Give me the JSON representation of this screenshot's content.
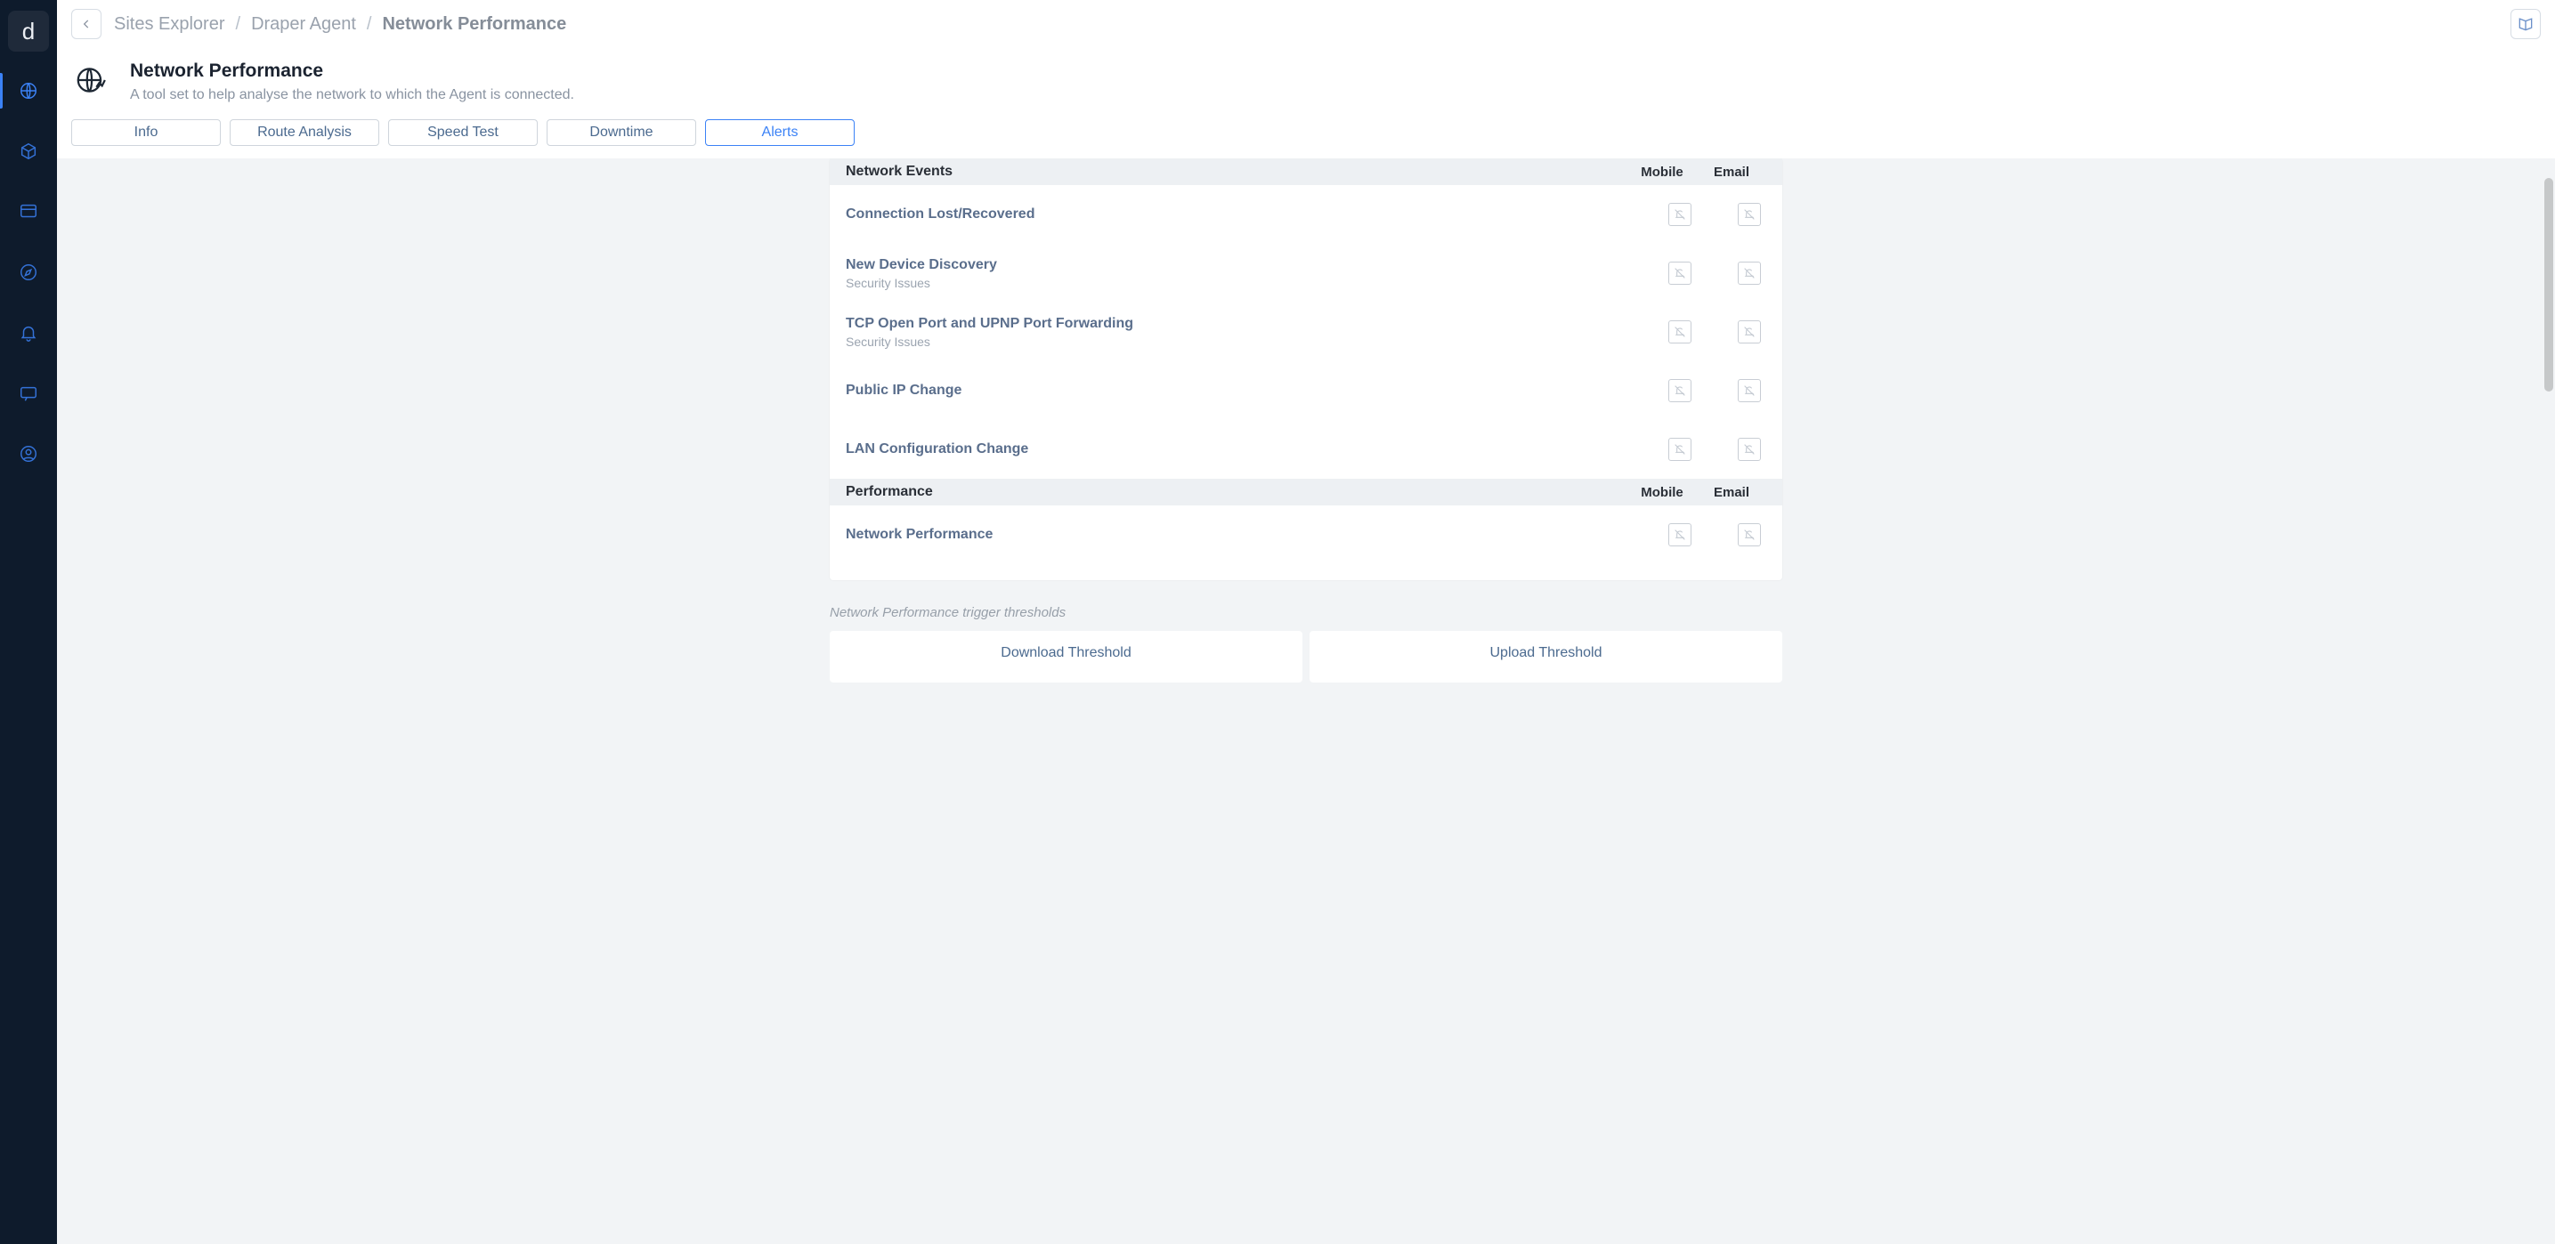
{
  "brand": {
    "logo_letter": "d"
  },
  "sidebar": {
    "items": [
      {
        "name": "globe-icon",
        "active": true
      },
      {
        "name": "box-icon",
        "active": false
      },
      {
        "name": "dashboard-icon",
        "active": false
      },
      {
        "name": "compass-icon",
        "active": false
      },
      {
        "name": "bell-icon",
        "active": false
      },
      {
        "name": "message-icon",
        "active": false
      },
      {
        "name": "user-icon",
        "active": false
      }
    ]
  },
  "breadcrumb": {
    "items": [
      "Sites Explorer",
      "Draper Agent",
      "Network Performance"
    ]
  },
  "page": {
    "title": "Network Performance",
    "subtitle": "A tool set to help analyse the network to which the Agent is connected."
  },
  "tabs": [
    "Info",
    "Route Analysis",
    "Speed Test",
    "Downtime",
    "Alerts"
  ],
  "active_tab": "Alerts",
  "columns": {
    "mobile": "Mobile",
    "email": "Email"
  },
  "sections": [
    {
      "label": "Network Events",
      "rows": [
        {
          "title": "Connection Lost/Recovered",
          "sub": ""
        },
        {
          "title": "New Device Discovery",
          "sub": "Security Issues"
        },
        {
          "title": "TCP Open Port and UPNP Port Forwarding",
          "sub": "Security Issues"
        },
        {
          "title": "Public IP Change",
          "sub": ""
        },
        {
          "title": "LAN Configuration Change",
          "sub": ""
        }
      ]
    },
    {
      "label": "Performance",
      "rows": [
        {
          "title": "Network Performance",
          "sub": ""
        }
      ]
    }
  ],
  "thresholds": {
    "caption": "Network Performance trigger thresholds",
    "cards": [
      "Download Threshold",
      "Upload Threshold"
    ]
  }
}
